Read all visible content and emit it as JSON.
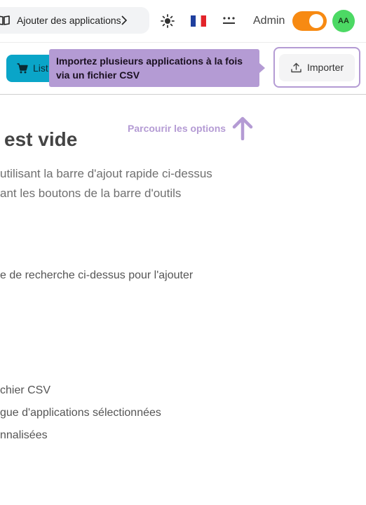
{
  "header": {
    "add_apps_label": "Ajouter des applications",
    "user_label": "Admin",
    "avatar_initials": "AA",
    "theme_icon": "sun-icon",
    "language_flag": "🇫🇷",
    "toggle_on": true
  },
  "toolbar": {
    "list_label": "List",
    "tooltip_text": "Importez plusieurs applications à la fois via un fichier CSV",
    "import_label": "Importer"
  },
  "main": {
    "browse_hint": "Parcourir les options",
    "title": " est vide",
    "lines": [
      "utilisant la barre d'ajout rapide ci-dessus",
      "ant les boutons de la barre d'outils"
    ],
    "search_hint": "e de recherche ci-dessus pour l'ajouter",
    "options": [
      "chier CSV",
      "gue d'applications sélectionnées",
      "nnalisées"
    ]
  },
  "colors": {
    "accent_purple": "#b49bd4",
    "list_button": "#0aa5c8",
    "toggle": "#f78a12",
    "avatar": "#4cd964"
  }
}
